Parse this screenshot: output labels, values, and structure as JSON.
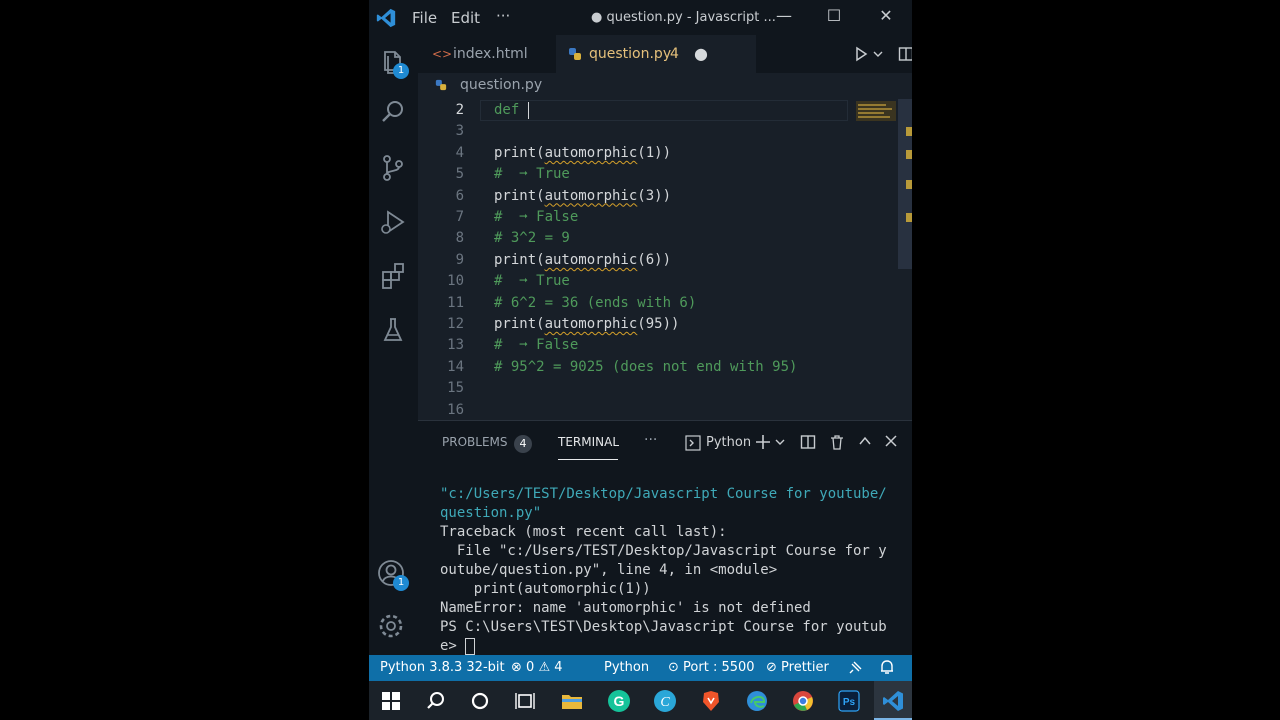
{
  "titlebar": {
    "menu_file": "File",
    "menu_edit": "Edit",
    "menu_more": "···",
    "title": "● question.py - Javascript ...",
    "minimize": "—",
    "maximize": "☐",
    "close": "✕"
  },
  "activity_bar": {
    "explorer_badge": "1",
    "accounts_badge": "1"
  },
  "tabs": [
    {
      "label": "index.html",
      "icon": "html-icon"
    },
    {
      "label": "question.py",
      "icon": "python-icon",
      "problems": "4",
      "modified": "●"
    }
  ],
  "breadcrumb": {
    "file": "question.py"
  },
  "editor": {
    "lines": [
      {
        "num": "2",
        "text": "def ",
        "kind": "kw"
      },
      {
        "num": "3",
        "text": "",
        "kind": "code"
      },
      {
        "num": "4",
        "pre": "print(",
        "fn": "automorphic",
        "post": "(1))",
        "kind": "call"
      },
      {
        "num": "5",
        "text": "#  ➞ True",
        "kind": "comment"
      },
      {
        "num": "6",
        "pre": "print(",
        "fn": "automorphic",
        "post": "(3))",
        "kind": "call"
      },
      {
        "num": "7",
        "text": "#  ➞ False",
        "kind": "comment"
      },
      {
        "num": "8",
        "text": "# 3^2 = 9",
        "kind": "comment"
      },
      {
        "num": "9",
        "pre": "print(",
        "fn": "automorphic",
        "post": "(6))",
        "kind": "call"
      },
      {
        "num": "10",
        "text": "#  ➞ True",
        "kind": "comment"
      },
      {
        "num": "11",
        "text": "# 6^2 = 36 (ends with 6)",
        "kind": "comment"
      },
      {
        "num": "12",
        "pre": "print(",
        "fn": "automorphic",
        "post": "(95))",
        "kind": "call"
      },
      {
        "num": "13",
        "text": "#  ➞ False",
        "kind": "comment"
      },
      {
        "num": "14",
        "text": "# 95^2 = 9025 (does not end with 95)",
        "kind": "comment"
      },
      {
        "num": "15",
        "text": "",
        "kind": "code"
      },
      {
        "num": "16",
        "text": "",
        "kind": "code"
      }
    ]
  },
  "panel": {
    "problems_label": "PROBLEMS",
    "problems_count": "4",
    "terminal_label": "TERMINAL",
    "more": "···",
    "shell": "Python",
    "terminal_lines": [
      {
        "text": "\"c:/Users/TEST/Desktop/Javascript Course for youtube/",
        "cls": "path"
      },
      {
        "text": "question.py\"",
        "cls": "path"
      },
      {
        "text": "Traceback (most recent call last):",
        "cls": ""
      },
      {
        "text": "  File \"c:/Users/TEST/Desktop/Javascript Course for y",
        "cls": ""
      },
      {
        "text": "outube/question.py\", line 4, in <module>",
        "cls": ""
      },
      {
        "text": "    print(automorphic(1))",
        "cls": ""
      },
      {
        "text": "NameError: name 'automorphic' is not defined",
        "cls": ""
      },
      {
        "text": "PS C:\\Users\\TEST\\Desktop\\Javascript Course for youtub",
        "cls": ""
      },
      {
        "text": "e> ",
        "cls": "prompt"
      }
    ]
  },
  "statusbar": {
    "interpreter": "Python 3.8.3 32-bit",
    "errors": "0",
    "warnings": "4",
    "language": "Python",
    "port": "Port : 5500",
    "prettier": "Prettier"
  },
  "colors": {
    "accent": "#0f6fa8",
    "comment": "#4f9a5b",
    "modified_tab": "#e5c07b",
    "warning_squiggle": "#d4a02a"
  }
}
